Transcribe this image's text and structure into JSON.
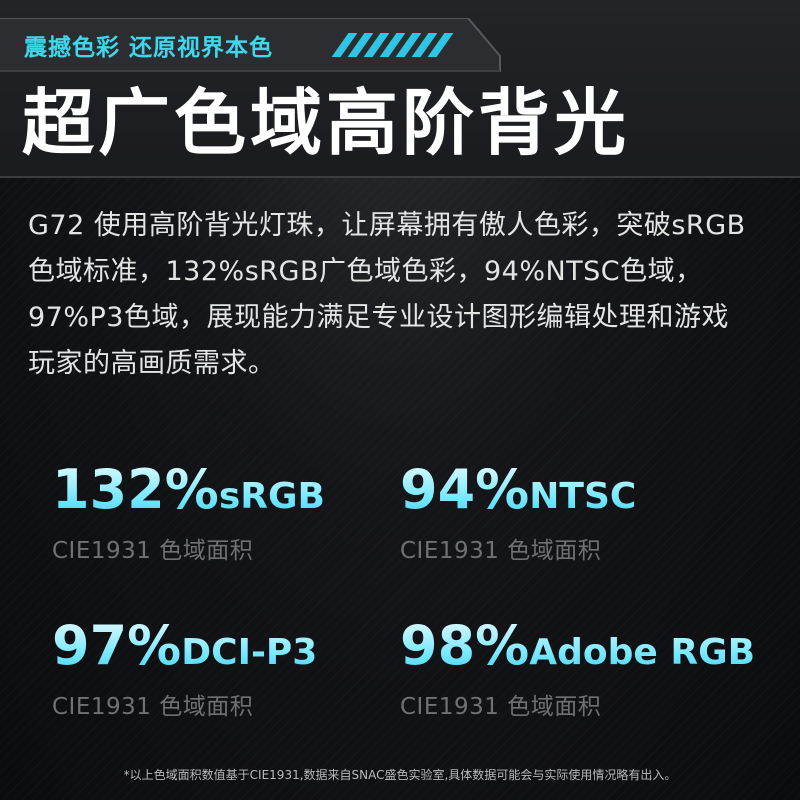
{
  "header": {
    "tagline": "震撼色彩 还原视界本色",
    "headline": "超广色域高阶背光"
  },
  "description": "G72 使用高阶背光灯珠，让屏幕拥有傲人色彩，突破sRGB色域标准，132%sRGB广色域色彩，94%NTSC色域，97%P3色域，展现能力满足专业设计图形编辑处理和游戏玩家的高画质需求。",
  "stats": [
    {
      "number": "132%",
      "unit": "sRGB",
      "caption": "CIE1931 色域面积"
    },
    {
      "number": "94%",
      "unit": "NTSC",
      "caption": "CIE1931 色域面积"
    },
    {
      "number": "97%",
      "unit": "DCI-P3",
      "caption": "CIE1931 色域面积"
    },
    {
      "number": "98%",
      "unit": "Adobe RGB",
      "caption": "CIE1931 色域面积"
    }
  ],
  "footnote": "*以上色域面积数值基于CIE1931,数据来自SNAC盛色实验室,具体数据可能会与实际使用情况略有出入。",
  "colors": {
    "accent": "#3fd7ee",
    "background": "#0d0e10",
    "text": "#e4e4e4",
    "caption": "#6f7175"
  }
}
